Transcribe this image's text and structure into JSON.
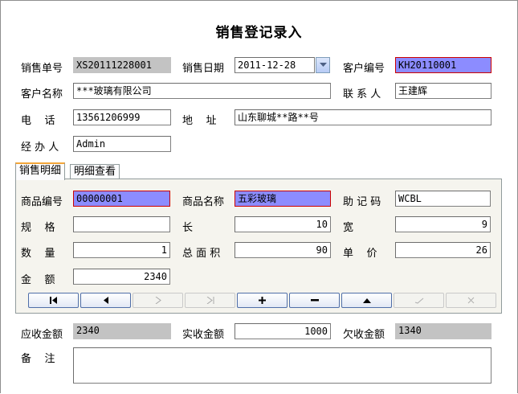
{
  "title": "销售登记录入",
  "header": {
    "sale_no_label": "销售单号",
    "sale_no": "XS20111228001",
    "sale_date_label": "销售日期",
    "sale_date": "2011-12-28",
    "customer_no_label": "客户编号",
    "customer_no": "KH20110001",
    "customer_name_label": "客户名称",
    "customer_name": "***玻璃有限公司",
    "contact_label": "联 系 人",
    "contact": "王建辉",
    "phone_label": "电    话",
    "phone": "13561206999",
    "address_label": "地    址",
    "address": "山东聊城**路**号",
    "handler_label": "经 办 人",
    "handler": "Admin"
  },
  "tabs": [
    "销售明细",
    "明细查看"
  ],
  "detail": {
    "product_no_label": "商品编号",
    "product_no": "00000001",
    "product_name_label": "商品名称",
    "product_name": "五彩玻璃",
    "mnemonic_label": "助 记 码",
    "mnemonic": "WCBL",
    "spec_label": "规    格",
    "spec": "",
    "length_label": "长",
    "length": "10",
    "width_label": "宽",
    "width": "9",
    "qty_label": "数    量",
    "qty": "1",
    "area_label": "总 面 积",
    "area": "90",
    "price_label": "单    价",
    "price": "26",
    "amount_label": "金    额",
    "amount": "2340"
  },
  "nav_buttons": [
    "first-icon",
    "prev-icon",
    "next-icon",
    "last-icon",
    "add-icon",
    "delete-icon",
    "up-icon",
    "confirm-icon",
    "cancel-icon"
  ],
  "footer": {
    "receivable_label": "应收金额",
    "receivable": "2340",
    "received_label": "实收金额",
    "received": "1000",
    "owed_label": "欠收金额",
    "owed": "1340",
    "remark_label": "备    注",
    "remark": ""
  },
  "colors": {
    "highlight": "#8c8cff",
    "highlight_border": "#cc0000",
    "readonly": "#c3c3c3",
    "panel": "#f5f4ee",
    "tab_accent": "#f3a63a"
  }
}
